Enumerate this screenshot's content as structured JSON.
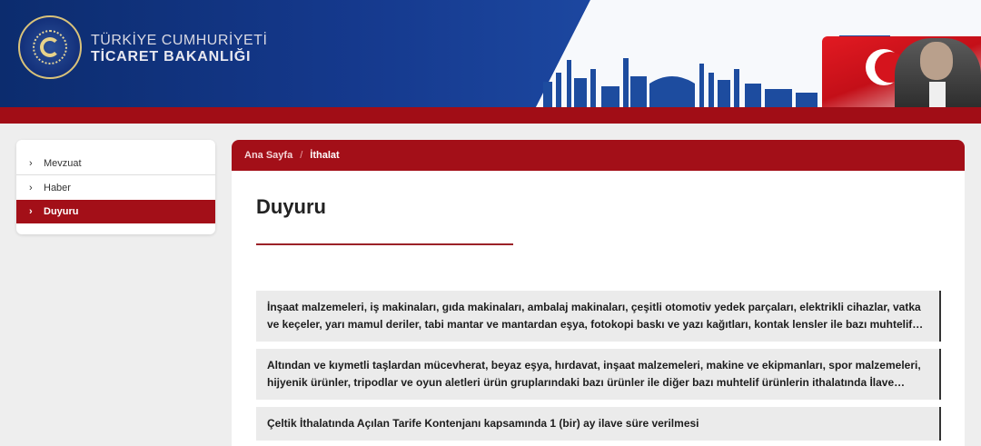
{
  "header": {
    "brand_line1": "TÜRKİYE CUMHURİYETİ",
    "brand_line2": "TİCARET BAKANLIĞI",
    "colors": {
      "navy": "#15388a",
      "accent_red": "#a30f18"
    }
  },
  "sidebar": {
    "items": [
      {
        "label": "Mevzuat",
        "active": false
      },
      {
        "label": "Haber",
        "active": false
      },
      {
        "label": "Duyuru",
        "active": true
      }
    ]
  },
  "breadcrumb": {
    "home": "Ana Sayfa",
    "separator": "/",
    "current": "İthalat"
  },
  "main": {
    "title": "Duyuru",
    "announcements": [
      {
        "text": "İnşaat malzemeleri, iş makinaları, gıda makinaları, ambalaj makinaları, çeşitli otomotiv yedek parçaları, elektrikli cihazlar, vatka ve keçeler, yarı mamul deriler, tabi mantar ve mantardan eşya, fotokopi baskı ve yazı kağıtları, kontak lensler ile bazı muhtelif ürünlerin ithalatında ilave gümrük vergisi uygulanmasına ilişkin karar"
      },
      {
        "text": "Altından ve kıymetli taşlardan mücevherat, beyaz eşya, hırdavat, inşaat malzemeleri, makine ve ekipmanları, spor malzemeleri, hijyenik ürünler, tripodlar ve oyun aletleri ürün gruplarındaki bazı ürünler ile diğer bazı muhtelif ürünlerin ithalatında İlave Gümrük Vergisi uygulanmasına ilişkin karar"
      },
      {
        "text": "Çeltik İthalatında Açılan Tarife Kontenjanı kapsamında 1 (bir) ay ilave süre verilmesi"
      }
    ]
  }
}
